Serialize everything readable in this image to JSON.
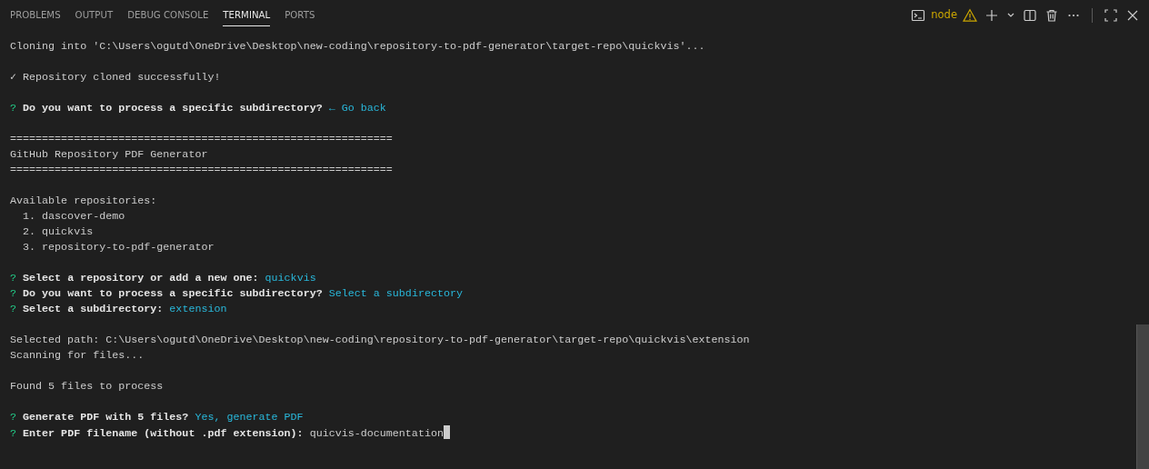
{
  "tabs": [
    {
      "label": "PROBLEMS",
      "selected": false
    },
    {
      "label": "OUTPUT",
      "selected": false
    },
    {
      "label": "DEBUG CONSOLE",
      "selected": false
    },
    {
      "label": "TERMINAL",
      "selected": true
    },
    {
      "label": "PORTS",
      "selected": false
    }
  ],
  "terminal_name": "node",
  "terminal": {
    "blocks": [
      [
        {
          "kind": "plain",
          "text": "Cloning into 'C:\\Users\\ogutd\\OneDrive\\Desktop\\new-coding\\repository-to-pdf-generator\\target-repo\\quickvis'..."
        }
      ],
      [
        {
          "kind": "success",
          "mark": "✓",
          "text": "Repository cloned successfully!"
        }
      ],
      [
        {
          "kind": "prompt",
          "mark": "?",
          "question": "Do you want to process a specific subdirectory?",
          "answer": "← Go back"
        }
      ],
      [
        {
          "kind": "plain",
          "text": "============================================================"
        },
        {
          "kind": "plain",
          "text": "GitHub Repository PDF Generator"
        },
        {
          "kind": "plain",
          "text": "============================================================"
        }
      ],
      [
        {
          "kind": "plain",
          "text": "Available repositories:"
        },
        {
          "kind": "plain",
          "text": "  1. dascover-demo"
        },
        {
          "kind": "plain",
          "text": "  2. quickvis"
        },
        {
          "kind": "plain",
          "text": "  3. repository-to-pdf-generator"
        }
      ],
      [
        {
          "kind": "prompt",
          "mark": "?",
          "question": "Select a repository or add a new one:",
          "answer": "quickvis"
        },
        {
          "kind": "prompt",
          "mark": "?",
          "question": "Do you want to process a specific subdirectory?",
          "answer": "Select a subdirectory"
        },
        {
          "kind": "prompt",
          "mark": "?",
          "question": "Select a subdirectory:",
          "answer": "extension"
        }
      ],
      [
        {
          "kind": "plain",
          "text": "Selected path: C:\\Users\\ogutd\\OneDrive\\Desktop\\new-coding\\repository-to-pdf-generator\\target-repo\\quickvis\\extension"
        },
        {
          "kind": "plain",
          "text": "Scanning for files..."
        }
      ],
      [
        {
          "kind": "plain",
          "text": "Found 5 files to process"
        }
      ],
      [
        {
          "kind": "prompt",
          "mark": "?",
          "question": "Generate PDF with 5 files?",
          "answer": "Yes, generate PDF"
        },
        {
          "kind": "input",
          "mark": "?",
          "question": "Enter PDF filename (without .pdf extension):",
          "value": "quicvis-documentation"
        }
      ]
    ]
  }
}
